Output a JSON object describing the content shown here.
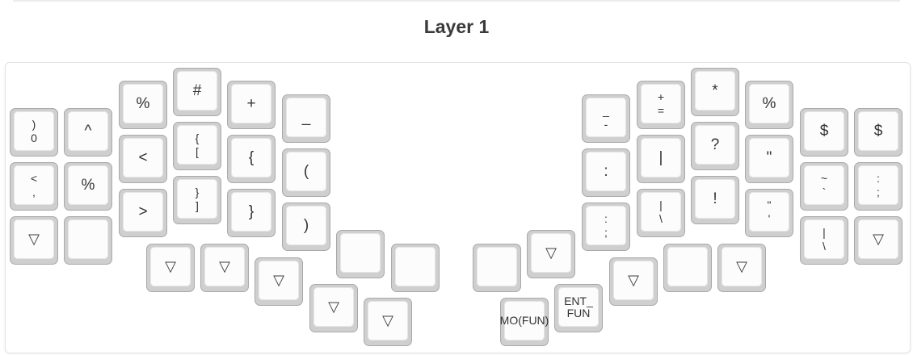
{
  "title": "Layer 1",
  "keys": [
    [
      "",
      ")",
      "0"
    ],
    [
      "",
      "^"
    ],
    [
      "",
      "%"
    ],
    [
      "",
      "#"
    ],
    [
      "",
      "+"
    ],
    [
      "",
      "_"
    ],
    [
      "",
      "<",
      ","
    ],
    [
      "",
      "%"
    ],
    [
      "",
      "<"
    ],
    [
      "",
      "{",
      "["
    ],
    [
      "",
      "{"
    ],
    [
      "",
      "("
    ],
    [
      "transparent",
      "▽"
    ],
    [
      "blank"
    ],
    [
      "",
      ">"
    ],
    [
      "",
      "}",
      "]"
    ],
    [
      "",
      "}"
    ],
    [
      "",
      ")"
    ],
    [
      "transparent",
      "▽"
    ],
    [
      "transparent",
      "▽"
    ],
    [
      "transparent",
      "▽"
    ],
    [
      "blank"
    ],
    [
      "blank"
    ],
    [
      "transparent",
      "▽"
    ],
    [
      "transparent",
      "▽"
    ],
    [
      "",
      "_",
      "-"
    ],
    [
      "",
      "+",
      "="
    ],
    [
      "",
      "*"
    ],
    [
      "",
      "%"
    ],
    [
      "",
      "$"
    ],
    [
      "",
      "$"
    ],
    [
      "",
      ":"
    ],
    [
      "",
      "|"
    ],
    [
      "",
      "?"
    ],
    [
      "",
      "\""
    ],
    [
      "",
      "~",
      "`"
    ],
    [
      "",
      ":",
      ";"
    ],
    [
      "",
      ":",
      ";"
    ],
    [
      "",
      "|",
      "\\"
    ],
    [
      "",
      "!"
    ],
    [
      "",
      "\"",
      "'"
    ],
    [
      "",
      "|",
      "\\"
    ],
    [
      "transparent",
      "▽"
    ],
    [
      "blank"
    ],
    [
      "blank"
    ],
    [
      "transparent",
      "▽"
    ],
    [
      "transparent",
      "▽"
    ],
    [
      "transparent",
      "▽"
    ],
    [
      "",
      "ENT_",
      "FUN"
    ],
    [
      "",
      "MO(FUN)"
    ]
  ]
}
